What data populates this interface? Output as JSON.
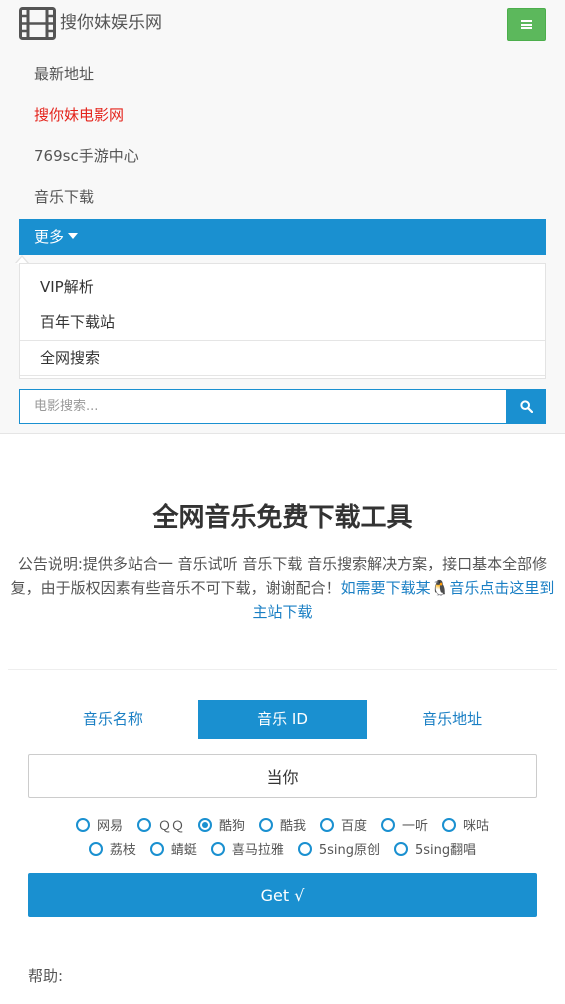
{
  "brand": {
    "name": "搜你妹娱乐网",
    "logo_icon": "film-strip-icon"
  },
  "nav": {
    "links": [
      {
        "label": "最新地址",
        "active": false
      },
      {
        "label": "搜你妹电影网",
        "active": true
      },
      {
        "label": "769sc手游中心",
        "active": false
      },
      {
        "label": "音乐下载",
        "active": false
      }
    ],
    "more_label": "更多",
    "dropdown": [
      "VIP解析",
      "百年下载站",
      "全网搜索"
    ]
  },
  "search": {
    "placeholder": "电影搜索...",
    "button_icon": "search-icon"
  },
  "main": {
    "title": "全网音乐免费下载工具",
    "notice_text": "公告说明:提供多站合一 音乐试听 音乐下载 音乐搜索解决方案，接口基本全部修复，由于版权因素有些音乐不可下载，谢谢配合！",
    "notice_link": "如需要下载某🐧音乐点击这里到主站下载",
    "tabs": [
      {
        "label": "音乐名称",
        "active": false
      },
      {
        "label": "音乐 ID",
        "active": true
      },
      {
        "label": "音乐地址",
        "active": false
      }
    ],
    "query_value": "当你",
    "sources_row1": [
      {
        "label": "网易",
        "checked": false
      },
      {
        "label": "ＱＱ",
        "checked": false
      },
      {
        "label": "酷狗",
        "checked": true
      },
      {
        "label": "酷我",
        "checked": false
      },
      {
        "label": "百度",
        "checked": false
      },
      {
        "label": "一听",
        "checked": false
      },
      {
        "label": "咪咕",
        "checked": false
      }
    ],
    "sources_row2": [
      {
        "label": "荔枝",
        "checked": false
      },
      {
        "label": "蜻蜓",
        "checked": false
      },
      {
        "label": "喜马拉雅",
        "checked": false
      },
      {
        "label": "5sing原创",
        "checked": false
      },
      {
        "label": "5sing翻唱",
        "checked": false
      }
    ],
    "get_label": "Get √",
    "help_label": "帮助:"
  },
  "colors": {
    "accent": "#1a90d0",
    "toggle": "#5cb85c",
    "active_link": "#e4231b"
  }
}
